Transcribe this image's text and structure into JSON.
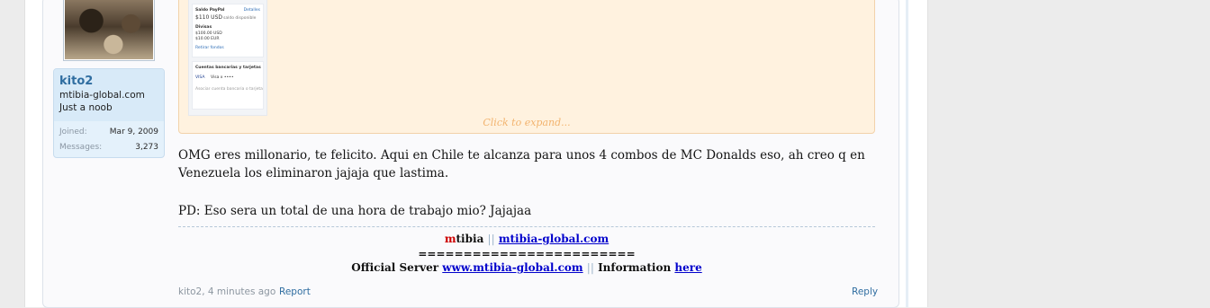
{
  "user": {
    "name": "kito2",
    "line1": "mtibia-global.com",
    "line2": "Just a noob",
    "joined_label": "Joined:",
    "joined_value": "Mar 9, 2009",
    "messages_label": "Messages:",
    "messages_value": "3,273"
  },
  "quote": {
    "expand_label": "Click to expand...",
    "screenshot": {
      "saldo_title": "Saldo PayPal",
      "detalles": "Detalles",
      "balance": "$110 USD",
      "balance_note": "saldo disponible",
      "divisas_title": "Divisas",
      "divisa_1": "$100.00 USD",
      "divisa_2": "$10.00 EUR",
      "retirar": "Retirar fondos",
      "cuentas_title": "Cuentas bancarias y tarjetas",
      "card_brand": "VISA",
      "card_line": "Visa x ••••",
      "add_link": "Asociar cuenta bancaria o tarjeta"
    }
  },
  "message": {
    "line1": "OMG eres millonario, te felicito. Aqui en Chile te alcanza para unos 4 combos de MC Donalds eso, ah creo q en",
    "line2": "Venezuela los eliminaron jajaja que lastima.",
    "line3": "PD: Eso sera un total de una hora de trabajo mio? Jajajaa"
  },
  "signature": {
    "brand_m": "m",
    "brand_rest": "tibia",
    "pipe": "||",
    "brand_link": "mtibia-global.com",
    "separator": "========================",
    "official_label": "Official Server",
    "server_link": "www.mtibia-global.com",
    "info_label": "Information",
    "here_link": "here"
  },
  "footer": {
    "meta": "kito2, 4 minutes ago",
    "report": "Report",
    "reply": "Reply"
  }
}
